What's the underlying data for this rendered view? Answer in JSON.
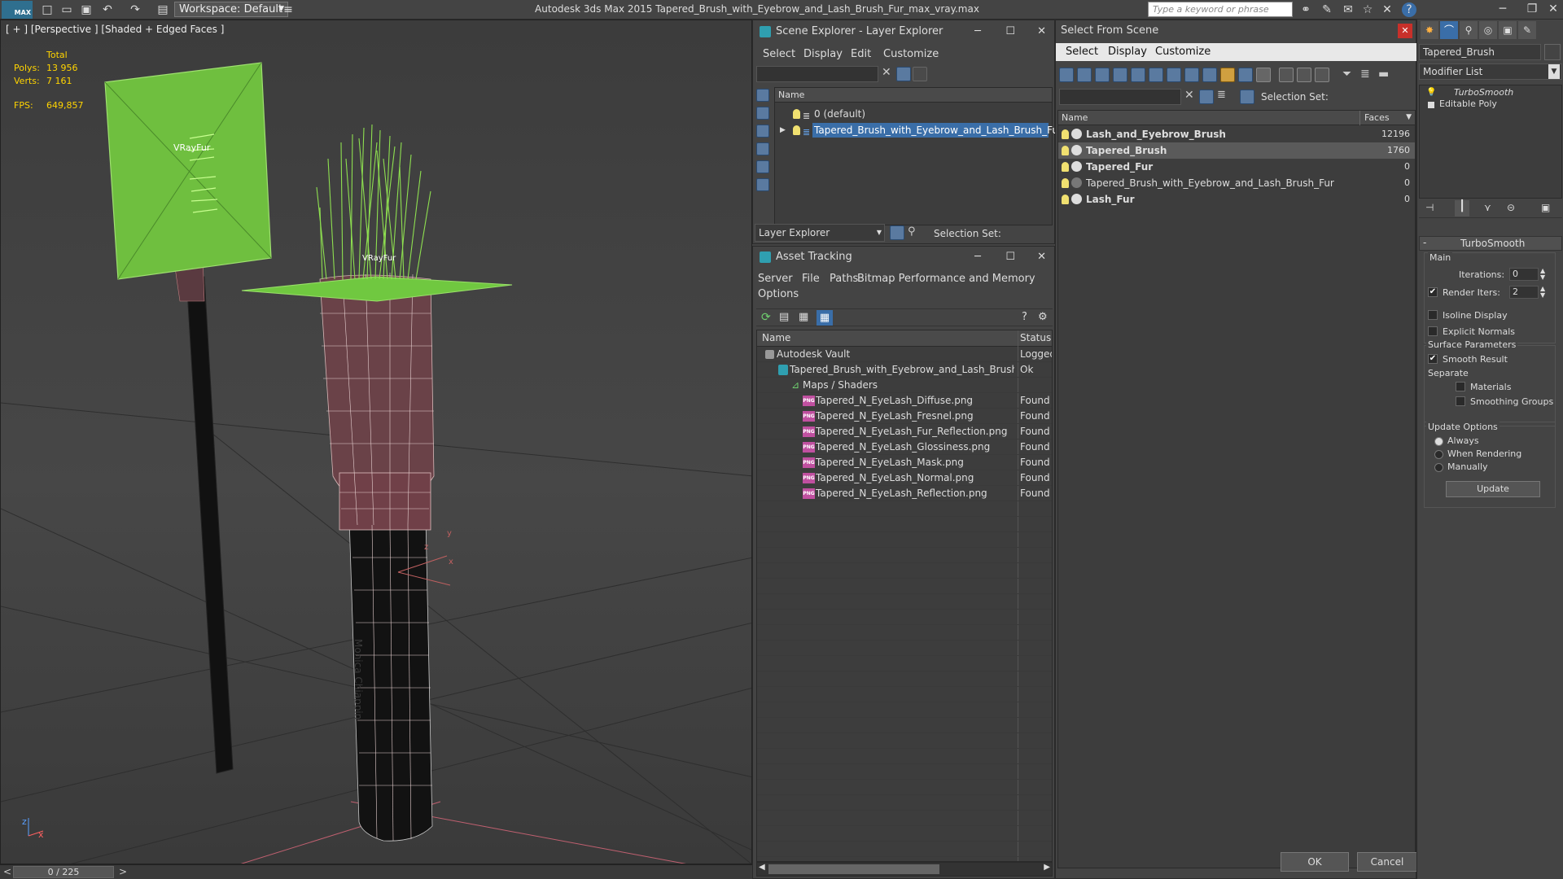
{
  "app": {
    "title": "Autodesk 3ds Max  2015    Tapered_Brush_with_Eyebrow_and_Lash_Brush_Fur_max_vray.max",
    "logo": "MAX",
    "workspace": "Workspace: Default",
    "search_placeholder": "Type a keyword or phrase"
  },
  "viewport": {
    "label": "[ + ] [Perspective ] [Shaded + Edged Faces ]",
    "stats": {
      "total_label": "Total",
      "polys_label": "Polys:",
      "polys_value": "13 956",
      "verts_label": "Verts:",
      "verts_value": "7 161",
      "fps_label": "FPS:",
      "fps_value": "649,857"
    },
    "fur_label_left": "VRayFur",
    "fur_label_right": "VRayFur",
    "watermark": "Monica Chiappin",
    "axis_z": "z",
    "axis_x": "x",
    "gizmo_y": "y",
    "gizmo_x": "x",
    "gizmo_z": "z"
  },
  "timeline": {
    "frame": "0 / 225",
    "prev": "<",
    "next": ">"
  },
  "scene_explorer": {
    "title": "Scene Explorer - Layer Explorer",
    "menu": [
      "Select",
      "Display",
      "Edit",
      "Customize"
    ],
    "column_name": "Name",
    "rows": [
      "0 (default)",
      "Tapered_Brush_with_Eyebrow_and_Lash_Brush_Fur"
    ],
    "footer_dropdown": "Layer Explorer",
    "selection_set_label": "Selection Set:"
  },
  "asset_tracking": {
    "title": "Asset Tracking",
    "menu": [
      "Server",
      "File",
      "Paths",
      "Bitmap Performance and Memory",
      "Options"
    ],
    "col_name": "Name",
    "col_status": "Status",
    "rows": [
      {
        "name": "Autodesk Vault",
        "status": "Logged"
      },
      {
        "name": "Tapered_Brush_with_Eyebrow_and_Lash_Brush_F...",
        "status": "Ok"
      },
      {
        "name": "Maps / Shaders",
        "status": ""
      },
      {
        "name": "Tapered_N_EyeLash_Diffuse.png",
        "status": "Found"
      },
      {
        "name": "Tapered_N_EyeLash_Fresnel.png",
        "status": "Found"
      },
      {
        "name": "Tapered_N_EyeLash_Fur_Reflection.png",
        "status": "Found"
      },
      {
        "name": "Tapered_N_EyeLash_Glossiness.png",
        "status": "Found"
      },
      {
        "name": "Tapered_N_EyeLash_Mask.png",
        "status": "Found"
      },
      {
        "name": "Tapered_N_EyeLash_Normal.png",
        "status": "Found"
      },
      {
        "name": "Tapered_N_EyeLash_Reflection.png",
        "status": "Found"
      }
    ]
  },
  "select_from_scene": {
    "title": "Select From Scene",
    "menu": [
      "Select",
      "Display",
      "Customize"
    ],
    "selection_set_label": "Selection Set:",
    "col_name": "Name",
    "col_faces": "Faces",
    "rows": [
      {
        "name": "Lash_and_Eyebrow_Brush",
        "faces": "12196"
      },
      {
        "name": "Tapered_Brush",
        "faces": "1760"
      },
      {
        "name": "Tapered_Fur",
        "faces": "0"
      },
      {
        "name": "Tapered_Brush_with_Eyebrow_and_Lash_Brush_Fur",
        "faces": "0"
      },
      {
        "name": "Lash_Fur",
        "faces": "0"
      }
    ],
    "ok": "OK",
    "cancel": "Cancel"
  },
  "command_panel": {
    "object_name": "Tapered_Brush",
    "modifier_list": "Modifier List",
    "stack": [
      "TurboSmooth",
      "Editable Poly"
    ],
    "rollout_title": "TurboSmooth",
    "main_label": "Main",
    "iterations_label": "Iterations:",
    "iterations_value": "0",
    "render_iters_label": "Render Iters:",
    "render_iters_value": "2",
    "isoline_label": "Isoline Display",
    "explicit_normals_label": "Explicit Normals",
    "surface_params_label": "Surface Parameters",
    "smooth_result_label": "Smooth Result",
    "separate_label": "Separate",
    "materials_label": "Materials",
    "smoothing_groups_label": "Smoothing Groups",
    "update_options_label": "Update Options",
    "always_label": "Always",
    "when_rendering_label": "When Rendering",
    "manually_label": "Manually",
    "update_button": "Update"
  },
  "colors": {
    "accent_blue": "#3a6ea8",
    "fur_green": "#7fd048",
    "stat_yellow": "#ffd400"
  }
}
